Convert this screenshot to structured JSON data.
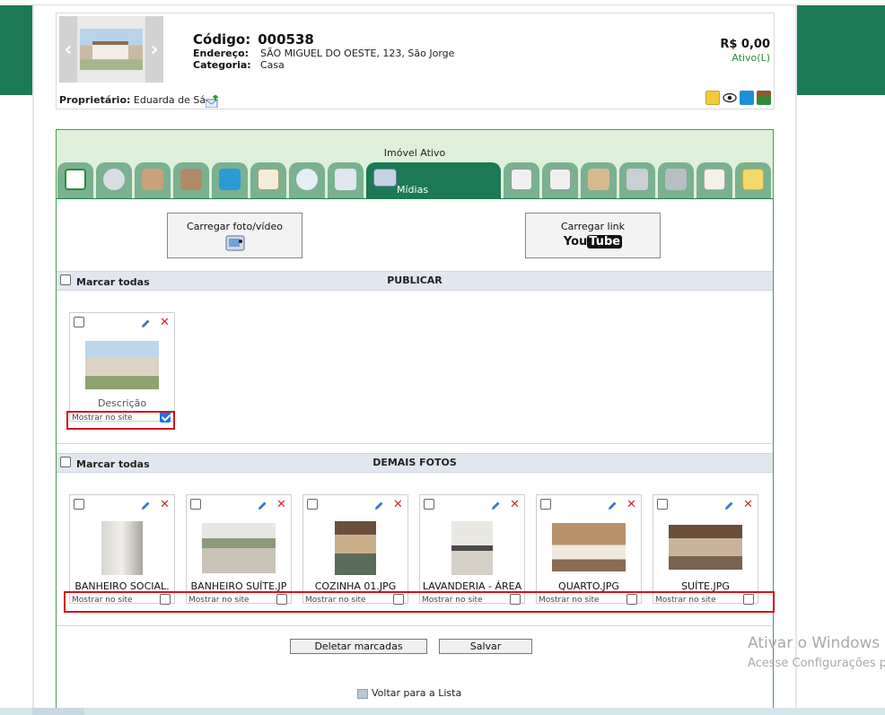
{
  "property": {
    "code_label": "Código:",
    "code_value": "000538",
    "address_label": "Endereço:",
    "address_value": "SÃO MIGUEL DO OESTE, 123, São Jorge",
    "category_label": "Categoria:",
    "category_value": "Casa",
    "price": "R$ 0,00",
    "status": "Ativo(L)",
    "owner_label": "Proprietário:",
    "owner_name": "Eduarda de Sá"
  },
  "ribbon": {
    "title": "Imóvel Ativo",
    "active_tab_label": "Mídias"
  },
  "upload": {
    "photo_video_label": "Carregar foto/vídeo",
    "link_label": "Carregar link",
    "youtube_logo_text_you": "You",
    "youtube_logo_text_tube": "Tube"
  },
  "publish_section": {
    "mark_all_label": "Marcar todas",
    "title": "PUBLICAR",
    "items": [
      {
        "label": "Descrição",
        "show_label": "Mostrar no site",
        "checked": true
      }
    ]
  },
  "other_section": {
    "mark_all_label": "Marcar todas",
    "title": "DEMAIS FOTOS",
    "items": [
      {
        "filename": "BANHEIRO SOCIAL.",
        "show_label": "Mostrar no site",
        "checked": false
      },
      {
        "filename": "BANHEIRO SUÍTE.JP",
        "show_label": "Mostrar no site",
        "checked": false
      },
      {
        "filename": "COZINHA 01.JPG",
        "show_label": "Mostrar no site",
        "checked": false
      },
      {
        "filename": "LAVANDERIA - ÁREA",
        "show_label": "Mostrar no site",
        "checked": false
      },
      {
        "filename": "QUARTO.JPG",
        "show_label": "Mostrar no site",
        "checked": false
      },
      {
        "filename": "SUÍTE.JPG",
        "show_label": "Mostrar no site",
        "checked": false
      }
    ]
  },
  "actions": {
    "delete_label": "Deletar marcadas",
    "save_label": "Salvar",
    "back_label": "Voltar para a Lista"
  },
  "watermark": {
    "line1": "Ativar o Windows",
    "line2": "Acesse Configurações p"
  },
  "colors": {
    "brand_green": "#1b7a55",
    "tab_green": "#7ab190",
    "ribbon_bg": "#dff0da",
    "highlight_red": "#d4121b",
    "status_green": "#2e8b3a"
  }
}
